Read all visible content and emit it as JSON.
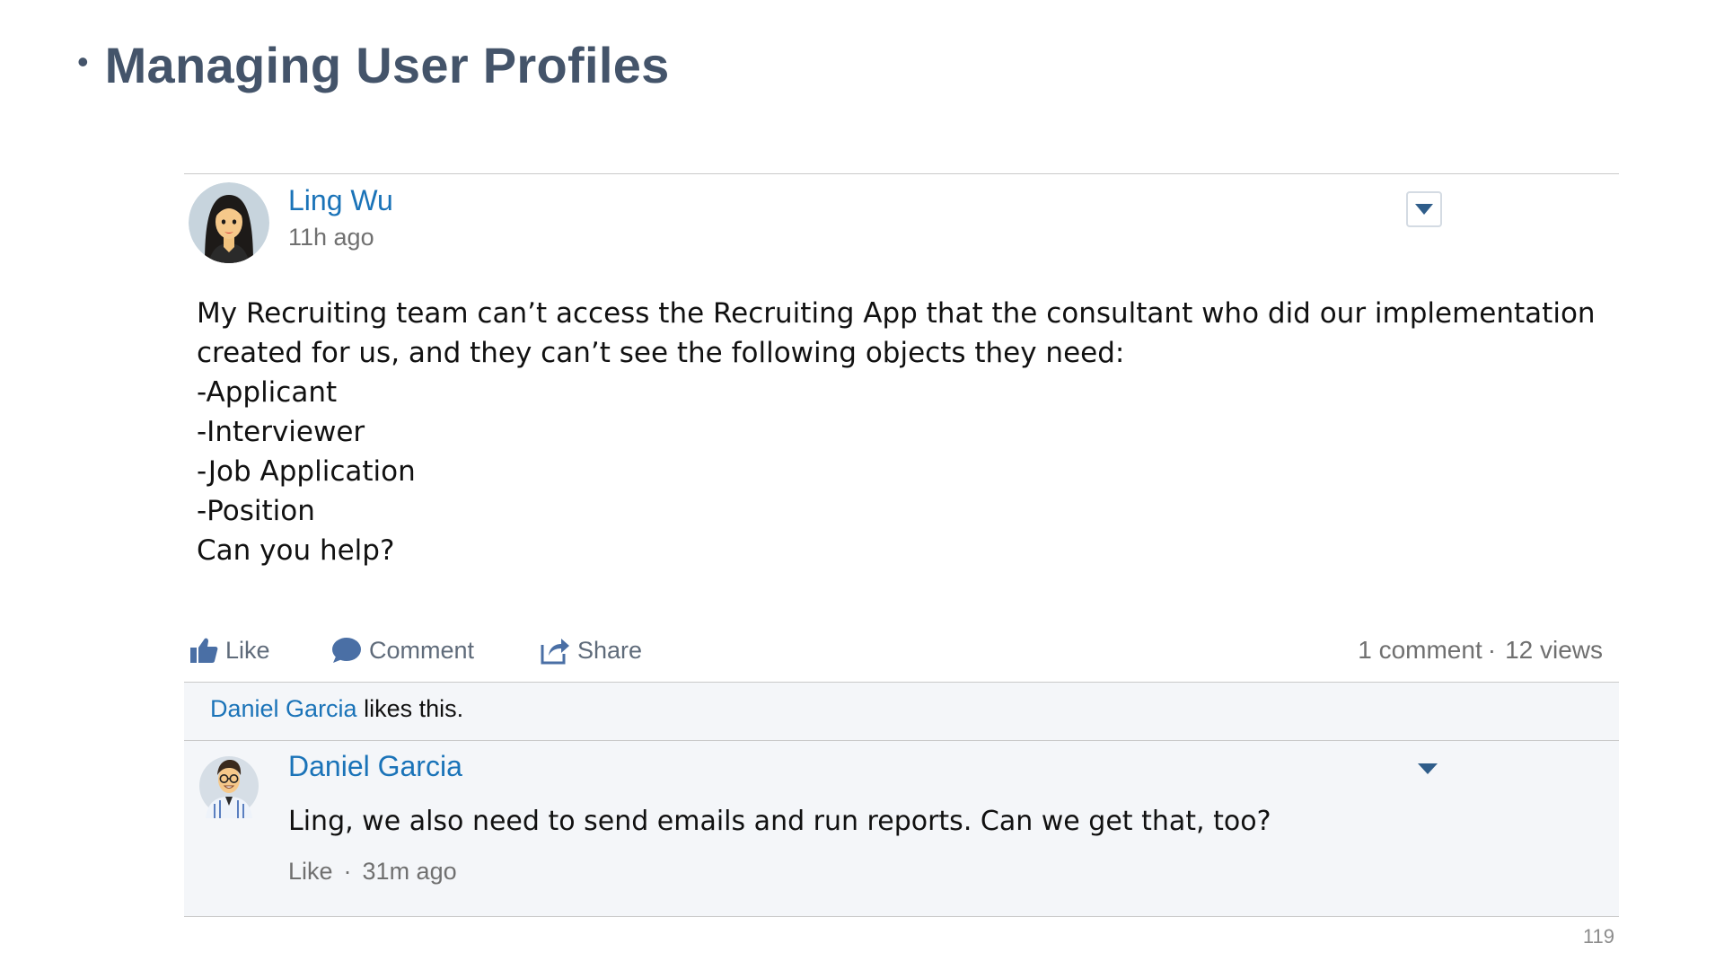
{
  "slide": {
    "title": "Managing User Profiles",
    "page_number": "119"
  },
  "post": {
    "author": "Ling Wu",
    "time": "11h ago",
    "menu_icon": "chevron-down-icon",
    "body_lines": [
      "My Recruiting team can’t access the Recruiting App that the consultant who did our implementation",
      "created for us, and they can’t see the following objects they need:",
      "-Applicant",
      "-Interviewer",
      "-Job Application",
      "-Position",
      "Can you help?"
    ],
    "actions": {
      "like": "Like",
      "comment": "Comment",
      "share": "Share"
    },
    "stats": {
      "comments": "1 comment",
      "separator": "·",
      "views": "12 views"
    },
    "likes": {
      "liker": "Daniel Garcia",
      "suffix": " likes this."
    }
  },
  "comment": {
    "author": "Daniel Garcia",
    "text": "Ling, we also need to send emails and run reports. Can we get that, too?",
    "like": "Like",
    "separator": "·",
    "time": "31m ago"
  },
  "colors": {
    "link": "#1a73b8",
    "title": "#44546a",
    "action": "#5f6b7a",
    "muted": "#707070",
    "panel": "#f4f6f9"
  }
}
